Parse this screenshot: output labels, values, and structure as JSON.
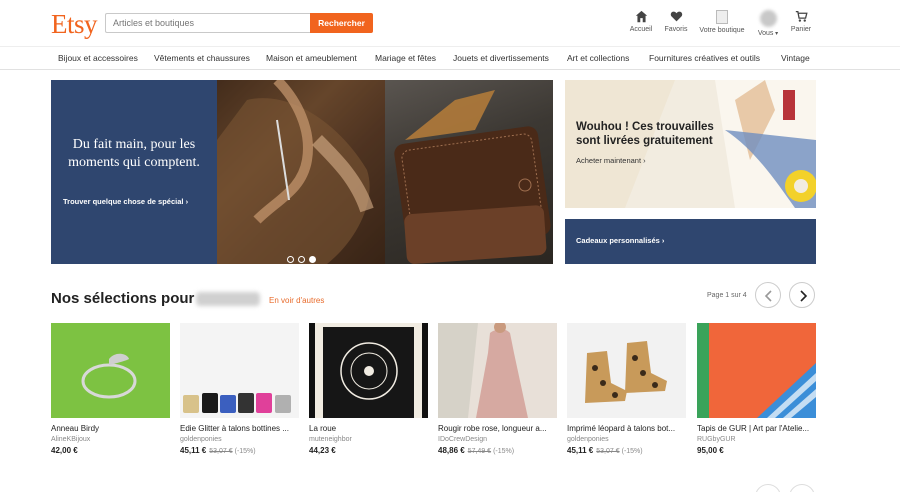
{
  "brand": {
    "logo": "Etsy",
    "accent": "#f1641e",
    "navy": "#2f466f"
  },
  "search": {
    "placeholder": "Articles et boutiques",
    "button": "Rechercher"
  },
  "nav": {
    "home": "Accueil",
    "favorites": "Favoris",
    "shop": "Votre boutique",
    "you": "Vous",
    "cart": "Panier"
  },
  "categories": [
    "Bijoux et accessoires",
    "Vêtements et chaussures",
    "Maison et ameublement",
    "Mariage et fêtes",
    "Jouets et divertissements",
    "Art et collections",
    "Fournitures créatives et outils",
    "Vintage"
  ],
  "hero": {
    "title": "Du fait main, pour les moments qui comptent.",
    "link": "Trouver quelque chose de spécial",
    "slides": 3,
    "active_slide": 3
  },
  "promo": {
    "title": "Wouhou ! Ces trouvailles sont livrées gratuitement",
    "link": "Acheter maintenant",
    "gifts_link": "Cadeaux personnalisés"
  },
  "picks": {
    "title": "Nos sélections pour",
    "see_more": "En voir d'autres",
    "page_indicator": "Page 1 sur 4",
    "items": [
      {
        "title": "Anneau Birdy",
        "shop": "AlineKBijoux",
        "price": "42,00 €",
        "old_price": "",
        "discount": ""
      },
      {
        "title": "Edie Glitter à talons bottines ...",
        "shop": "goldenponies",
        "price": "45,11 €",
        "old_price": "53,07 €",
        "discount": "(-15%)"
      },
      {
        "title": "La roue",
        "shop": "muteneighbor",
        "price": "44,23 €",
        "old_price": "",
        "discount": ""
      },
      {
        "title": "Rougir robe rose, longueur a...",
        "shop": "IDoCrewDesign",
        "price": "48,86 €",
        "old_price": "57,49 €",
        "discount": "(-15%)"
      },
      {
        "title": "Imprimé léopard à talons bot...",
        "shop": "goldenponies",
        "price": "45,11 €",
        "old_price": "53,07 €",
        "discount": "(-15%)"
      },
      {
        "title": "Tapis de GUR | Art par l'Atelie...",
        "shop": "RUGbyGUR",
        "price": "95,00 €",
        "old_price": "",
        "discount": ""
      }
    ]
  },
  "icons": [
    "home-icon",
    "heart-icon",
    "shop-icon",
    "avatar",
    "cart-icon",
    "chevron-left-icon",
    "chevron-right-icon",
    "chevron-down-icon"
  ]
}
